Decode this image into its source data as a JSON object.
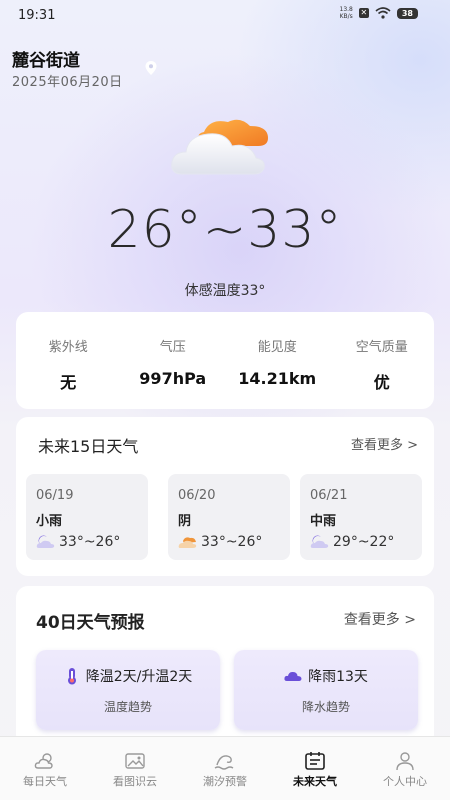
{
  "status_bar": {
    "time": "19:31",
    "net_speed_value": "13.8",
    "net_speed_unit": "KB/s",
    "battery": "38"
  },
  "header": {
    "location": "麓谷街道",
    "date": "2025年06月20日"
  },
  "current": {
    "icon": "partly-cloudy-icon",
    "temp_range": "26°~33°",
    "feels_like": "体感温度33°"
  },
  "metrics": [
    {
      "label": "紫外线",
      "value": "无"
    },
    {
      "label": "气压",
      "value": "997hPa"
    },
    {
      "label": "能见度",
      "value": "14.21km"
    },
    {
      "label": "空气质量",
      "value": "优"
    }
  ],
  "forecast_15": {
    "title": "未来15日天气",
    "more": "查看更多 >",
    "days": [
      {
        "date": "06/19",
        "condition": "小雨",
        "range": "33°~26°",
        "icon": "moon-cloud-icon"
      },
      {
        "date": "06/20",
        "condition": "阴",
        "range": "33°~26°",
        "icon": "overcast-icon"
      },
      {
        "date": "06/21",
        "condition": "中雨",
        "range": "29°~22°",
        "icon": "moon-cloud-icon"
      }
    ]
  },
  "forecast_40": {
    "title": "40日天气预报",
    "more": "查看更多 >",
    "cards": [
      {
        "top": "降温2天/升温2天",
        "bottom": "温度趋势",
        "icon": "thermometer-icon"
      },
      {
        "top": "降雨13天",
        "bottom": "降水趋势",
        "icon": "cloud-icon"
      }
    ]
  },
  "tabs": [
    {
      "label": "每日天气",
      "icon": "sun-cloud-icon",
      "active": false
    },
    {
      "label": "看图识云",
      "icon": "image-cloud-icon",
      "active": false
    },
    {
      "label": "潮汐预警",
      "icon": "wave-icon",
      "active": false
    },
    {
      "label": "未来天气",
      "icon": "calendar-icon",
      "active": true
    },
    {
      "label": "个人中心",
      "icon": "person-icon",
      "active": false
    }
  ],
  "colors": {
    "accent_orange": "#f0953a",
    "accent_purple": "#6a4fd8",
    "card_bg": "#ffffff"
  }
}
